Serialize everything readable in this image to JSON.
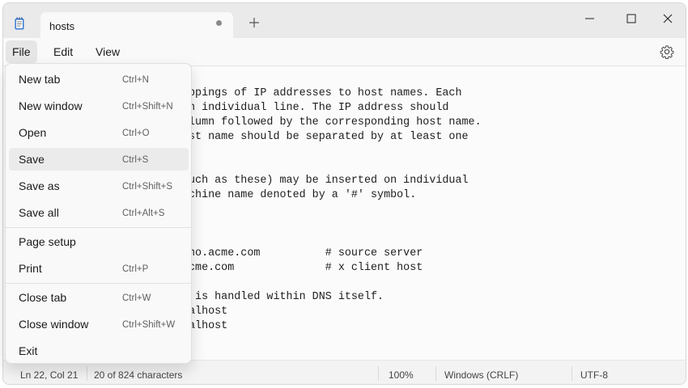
{
  "tab": {
    "title": "hosts",
    "modified_icon": "dot-icon"
  },
  "menubar": {
    "file": "File",
    "edit": "Edit",
    "view": "View"
  },
  "file_menu": {
    "new_tab": {
      "label": "New tab",
      "shortcut": "Ctrl+N"
    },
    "new_window": {
      "label": "New window",
      "shortcut": "Ctrl+Shift+N"
    },
    "open": {
      "label": "Open",
      "shortcut": "Ctrl+O"
    },
    "save": {
      "label": "Save",
      "shortcut": "Ctrl+S"
    },
    "save_as": {
      "label": "Save as",
      "shortcut": "Ctrl+Shift+S"
    },
    "save_all": {
      "label": "Save all",
      "shortcut": "Ctrl+Alt+S"
    },
    "page_setup": {
      "label": "Page setup"
    },
    "print": {
      "label": "Print",
      "shortcut": "Ctrl+P"
    },
    "close_tab": {
      "label": "Close tab",
      "shortcut": "Ctrl+W"
    },
    "close_window": {
      "label": "Close window",
      "shortcut": "Ctrl+Shift+W"
    },
    "exit": {
      "label": "Exit"
    }
  },
  "editor": {
    "lines": [
      "ppings of IP addresses to host names. Each",
      "n individual line. The IP address should",
      "lumn followed by the corresponding host name.",
      "st name should be separated by at least one",
      "",
      "",
      "uch as these) may be inserted on individual",
      "chine name denoted by a '#' symbol.",
      "",
      "",
      "",
      "no.acme.com          # source server",
      "cme.com              # x client host",
      "",
      " is handled within DNS itself.",
      "alhost",
      "alhost"
    ]
  },
  "statusbar": {
    "position": "Ln 22, Col 21",
    "selection": "20 of 824 characters",
    "zoom": "100%",
    "line_ending": "Windows (CRLF)",
    "encoding": "UTF-8"
  },
  "colors": {
    "accent": "#1a1a1a",
    "menu_hover": "#ebebeb",
    "editor_bg": "#fbfbfb"
  }
}
